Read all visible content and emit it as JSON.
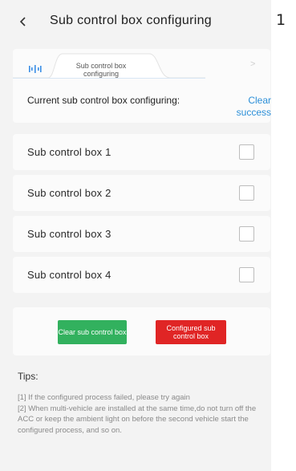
{
  "header": {
    "title": "Sub control box configuring",
    "back_icon": "chevron-left-icon"
  },
  "side_number": "1",
  "tabs": {
    "items": [
      {
        "label": "Sub control box configuring",
        "icon": "signal-bars-icon",
        "active": true
      }
    ],
    "next_icon": "chevron-right-icon"
  },
  "status": {
    "label": "Current sub control box configuring:",
    "value": "Clear success"
  },
  "boxes": [
    {
      "label": "Sub control box 1",
      "checked": false
    },
    {
      "label": "Sub control box 2",
      "checked": false
    },
    {
      "label": "Sub control box 3",
      "checked": false
    },
    {
      "label": "Sub control box 4",
      "checked": false
    }
  ],
  "buttons": {
    "clear_label": "Clear sub control box",
    "configured_label": "Configured sub control box"
  },
  "tips": {
    "title": "Tips:",
    "lines": [
      "[1] If the configured process failed, please try again",
      "[2] When multi-vehicle are installed at the same time,do not turn off the ACC or keep the ambient light on before the second vehicle start the configured process, and so on."
    ]
  },
  "colors": {
    "background": "#f3f3f3",
    "card": "#fbfbfb",
    "link_blue": "#2b8fd8",
    "clear_green": "#32b15e",
    "configured_red": "#e02525",
    "tab_icon_blue": "#3a8ee6"
  }
}
